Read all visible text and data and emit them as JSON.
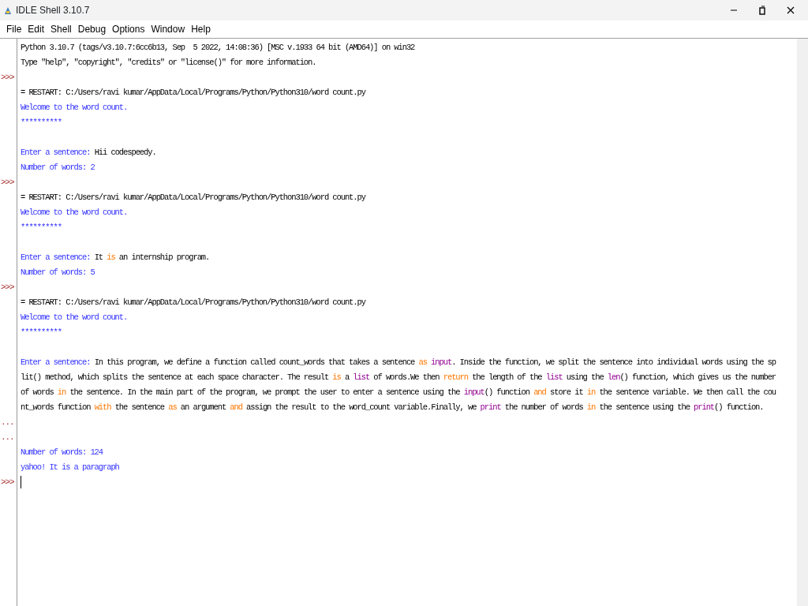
{
  "window": {
    "title": "IDLE Shell 3.10.7"
  },
  "menu": [
    "File",
    "Edit",
    "Shell",
    "Debug",
    "Options",
    "Window",
    "Help"
  ],
  "lines": [
    {
      "segments": [
        {
          "kind": "plain",
          "text": "Python 3.10.7 (tags/v3.10.7:6cc6b13, Sep  5 2022, 14:08:36) [MSC v.1933 64 bit (AMD64)] on win32"
        }
      ]
    },
    {
      "segments": [
        {
          "kind": "plain",
          "text": "Type \"help\", \"copyright\", \"credits\" or \"license()\" for more information."
        }
      ]
    },
    {
      "prompt": ">>>"
    },
    {
      "segments": [
        {
          "kind": "plain",
          "text": "= RESTART: C:/Users/ravi kumar/AppData/Local/Programs/Python/Python310/word count.py"
        }
      ]
    },
    {
      "segments": [
        {
          "kind": "stdout",
          "text": "Welcome to the word count."
        }
      ]
    },
    {
      "segments": [
        {
          "kind": "stdout",
          "text": "**********"
        }
      ]
    },
    {
      "gap_before": true,
      "segments": [
        {
          "kind": "stdout",
          "text": "Enter a sentence: "
        },
        {
          "kind": "plain",
          "text": "Hii codespeedy."
        }
      ]
    },
    {
      "segments": [
        {
          "kind": "stdout",
          "text": "Number of words: 2"
        }
      ]
    },
    {
      "prompt": ">>>"
    },
    {
      "segments": [
        {
          "kind": "plain",
          "text": "= RESTART: C:/Users/ravi kumar/AppData/Local/Programs/Python/Python310/word count.py"
        }
      ]
    },
    {
      "segments": [
        {
          "kind": "stdout",
          "text": "Welcome to the word count."
        }
      ]
    },
    {
      "segments": [
        {
          "kind": "stdout",
          "text": "**********"
        }
      ]
    },
    {
      "gap_before": true,
      "segments": [
        {
          "kind": "stdout",
          "text": "Enter a sentence: "
        },
        {
          "kind": "plain",
          "text": "It "
        },
        {
          "kind": "keyword",
          "text": "is"
        },
        {
          "kind": "plain",
          "text": " an internship program."
        }
      ]
    },
    {
      "segments": [
        {
          "kind": "stdout",
          "text": "Number of words: 5"
        }
      ]
    },
    {
      "prompt": ">>>"
    },
    {
      "segments": [
        {
          "kind": "plain",
          "text": "= RESTART: C:/Users/ravi kumar/AppData/Local/Programs/Python/Python310/word count.py"
        }
      ]
    },
    {
      "segments": [
        {
          "kind": "stdout",
          "text": "Welcome to the word count."
        }
      ]
    },
    {
      "segments": [
        {
          "kind": "stdout",
          "text": "**********"
        }
      ]
    },
    {
      "gap_before": true,
      "segments": [
        {
          "kind": "stdout",
          "text": "Enter a sentence: "
        },
        {
          "kind": "plain",
          "text": "In this program, we define a function called count_words that takes a sentence "
        },
        {
          "kind": "keyword",
          "text": "as"
        },
        {
          "kind": "builtin",
          "text": " input"
        },
        {
          "kind": "plain",
          "text": ". Inside the function, we split the sentence into individual words using the sp"
        }
      ]
    },
    {
      "segments": [
        {
          "kind": "plain",
          "text": "lit() method, which splits the sentence at each space character. The result "
        },
        {
          "kind": "keyword",
          "text": "is"
        },
        {
          "kind": "plain",
          "text": " a "
        },
        {
          "kind": "builtin",
          "text": "list"
        },
        {
          "kind": "plain",
          "text": " of words.We then "
        },
        {
          "kind": "keyword",
          "text": "return"
        },
        {
          "kind": "plain",
          "text": " the length of the "
        },
        {
          "kind": "builtin",
          "text": "list"
        },
        {
          "kind": "plain",
          "text": " using the "
        },
        {
          "kind": "builtin",
          "text": "len"
        },
        {
          "kind": "plain",
          "text": "() function, which gives us the number"
        }
      ]
    },
    {
      "segments": [
        {
          "kind": "plain",
          "text": "of words "
        },
        {
          "kind": "keyword",
          "text": "in"
        },
        {
          "kind": "plain",
          "text": " the sentence. In the main part of the program, we prompt the user to enter a sentence using the "
        },
        {
          "kind": "builtin",
          "text": "input"
        },
        {
          "kind": "plain",
          "text": "() function "
        },
        {
          "kind": "keyword",
          "text": "and"
        },
        {
          "kind": "plain",
          "text": " store it "
        },
        {
          "kind": "keyword",
          "text": "in"
        },
        {
          "kind": "plain",
          "text": " the sentence variable. We then call the cou"
        }
      ]
    },
    {
      "segments": [
        {
          "kind": "plain",
          "text": "nt_words function "
        },
        {
          "kind": "keyword",
          "text": "with"
        },
        {
          "kind": "plain",
          "text": " the sentence "
        },
        {
          "kind": "keyword",
          "text": "as"
        },
        {
          "kind": "plain",
          "text": " an argument "
        },
        {
          "kind": "keyword",
          "text": "and"
        },
        {
          "kind": "plain",
          "text": " assign the result to the word_count variable.Finally, we "
        },
        {
          "kind": "builtin",
          "text": "print"
        },
        {
          "kind": "plain",
          "text": " the number of words "
        },
        {
          "kind": "keyword",
          "text": "in"
        },
        {
          "kind": "plain",
          "text": " the sentence using the "
        },
        {
          "kind": "builtin",
          "text": "print"
        },
        {
          "kind": "plain",
          "text": "() function."
        }
      ]
    },
    {
      "prompt": "..."
    },
    {
      "prompt": "..."
    },
    {
      "segments": [
        {
          "kind": "stdout",
          "text": "Number of words: 124"
        }
      ]
    },
    {
      "segments": [
        {
          "kind": "stdout",
          "text": "yahoo! It is a paragraph"
        }
      ]
    },
    {
      "prompt": ">>>",
      "cursor": true
    }
  ]
}
